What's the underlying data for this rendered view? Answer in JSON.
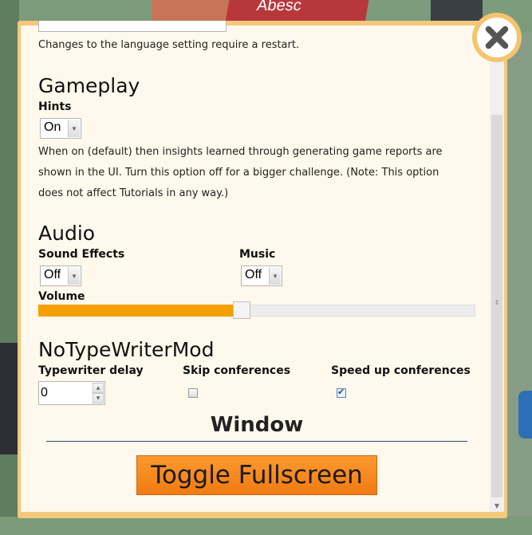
{
  "background": {
    "sign_text": "Abesc"
  },
  "language": {
    "note": "Changes to the language setting require a restart."
  },
  "gameplay": {
    "heading": "Gameplay",
    "hints_label": "Hints",
    "hints_value": "On",
    "description_lines": [
      "When on (default) then insights learned through generating game reports are",
      "shown in the UI. Turn this option off for a bigger challenge. (Note: This option",
      "does not affect Tutorials in any way.)"
    ]
  },
  "audio": {
    "heading": "Audio",
    "sound_effects_label": "Sound Effects",
    "sound_effects_value": "Off",
    "music_label": "Music",
    "music_value": "Off",
    "volume_label": "Volume",
    "volume_fraction": 0.45
  },
  "mod": {
    "heading": "NoTypeWriterMod",
    "typewriter_delay_label": "Typewriter delay",
    "typewriter_delay_value": "0",
    "skip_conferences_label": "Skip conferences",
    "skip_conferences_checked": false,
    "speed_up_conferences_label": "Speed up conferences",
    "speed_up_conferences_checked": true
  },
  "window": {
    "heading": "Window",
    "toggle_fullscreen_label": "Toggle Fullscreen"
  },
  "colors": {
    "accent_orange": "#f5a000",
    "dialog_border": "#f2c97b",
    "panel_bg": "#fff8ec"
  },
  "icons": {
    "close": "close-x-icon"
  }
}
